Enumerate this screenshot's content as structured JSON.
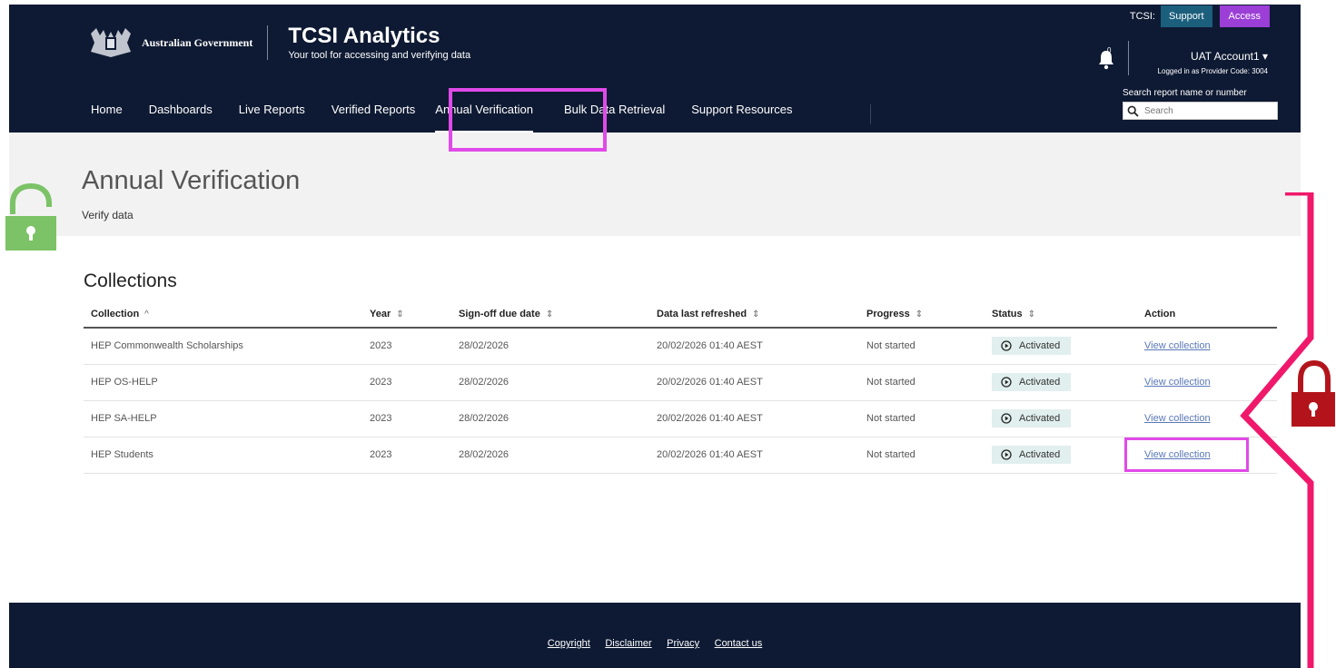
{
  "header": {
    "government_name": "Australian Government",
    "app_title": "TCSI Analytics",
    "app_subtitle": "Your tool for accessing and verifying data",
    "tcsi_label": "TCSI:",
    "tcsi_support": "Support",
    "tcsi_access": "Access",
    "notification_count": "0",
    "account_name": "UAT Account1 ▾",
    "account_sub": "Logged in as Provider Code: 3004",
    "search_label": "Search report name or number",
    "search_placeholder": "Search"
  },
  "nav": {
    "items": [
      {
        "label": "Home"
      },
      {
        "label": "Dashboards"
      },
      {
        "label": "Live Reports"
      },
      {
        "label": "Verified Reports"
      },
      {
        "label": "Annual Verification"
      },
      {
        "label": "Bulk Data Retrieval"
      },
      {
        "label": "Support Resources"
      }
    ],
    "active": "Annual Verification"
  },
  "page": {
    "title": "Annual Verification",
    "subtitle": "Verify data",
    "section_title": "Collections"
  },
  "table": {
    "columns": [
      {
        "label": "Collection",
        "sort": "^"
      },
      {
        "label": "Year",
        "sort": "⇕"
      },
      {
        "label": "Sign-off due date",
        "sort": "⇕"
      },
      {
        "label": "Data last refreshed",
        "sort": "⇕"
      },
      {
        "label": "Progress",
        "sort": "⇕"
      },
      {
        "label": "Status",
        "sort": "⇕"
      },
      {
        "label": "Action",
        "sort": ""
      }
    ],
    "rows": [
      {
        "collection": "HEP Commonwealth Scholarships",
        "year": "2023",
        "due": "28/02/2026",
        "refreshed": "20/02/2026 01:40 AEST",
        "progress": "Not started",
        "status": "Activated",
        "action": "View collection"
      },
      {
        "collection": "HEP OS-HELP",
        "year": "2023",
        "due": "28/02/2026",
        "refreshed": "20/02/2026 01:40 AEST",
        "progress": "Not started",
        "status": "Activated",
        "action": "View collection"
      },
      {
        "collection": "HEP SA-HELP",
        "year": "2023",
        "due": "28/02/2026",
        "refreshed": "20/02/2026 01:40 AEST",
        "progress": "Not started",
        "status": "Activated",
        "action": "View collection"
      },
      {
        "collection": "HEP Students",
        "year": "2023",
        "due": "28/02/2026",
        "refreshed": "20/02/2026 01:40 AEST",
        "progress": "Not started",
        "status": "Activated",
        "action": "View collection"
      }
    ]
  },
  "footer": {
    "links": [
      "Copyright",
      "Disclaimer",
      "Privacy",
      "Contact us"
    ]
  },
  "colors": {
    "header_bg": "#0e1a33",
    "highlight": "#e04ae8",
    "unlock_green": "#7cc267",
    "lock_red": "#b3141b",
    "bracket_pink": "#f0186b",
    "status_chip": "#e1efee",
    "link": "#5a78b8"
  }
}
